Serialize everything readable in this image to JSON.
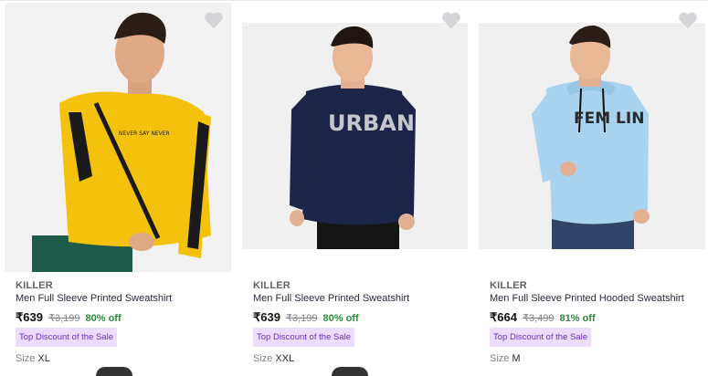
{
  "products": [
    {
      "brand": "KILLER",
      "title": "Men Full Sleeve Printed Sweatshirt",
      "price": "₹639",
      "mrp": "₹3,199",
      "discount": "80% off",
      "badge": "Top Discount of the Sale",
      "size_label": "Size",
      "size": "XL",
      "graphic_text": "NEVER SAY NEVER",
      "sweatshirt_color": "#f4c20d",
      "icon": "heart-icon"
    },
    {
      "brand": "KILLER",
      "title": "Men Full Sleeve Printed Sweatshirt",
      "price": "₹639",
      "mrp": "₹3,199",
      "discount": "80% off",
      "badge": "Top Discount of the Sale",
      "size_label": "Size",
      "size": "XXL",
      "graphic_text": "URBAN",
      "sweatshirt_color": "#1c2447",
      "icon": "heart-icon"
    },
    {
      "brand": "KILLER",
      "title": "Men Full Sleeve Printed Hooded Sweatshirt",
      "price": "₹664",
      "mrp": "₹3,499",
      "discount": "81% off",
      "badge": "Top Discount of the Sale",
      "size_label": "Size",
      "size": "M",
      "graphic_text": "FEM LIN",
      "sweatshirt_color": "#a9d3ee",
      "icon": "heart-icon"
    }
  ],
  "colors": {
    "discount_green": "#2e8b3e",
    "badge_bg": "#ecdcff",
    "badge_text": "#6b2fbf"
  }
}
